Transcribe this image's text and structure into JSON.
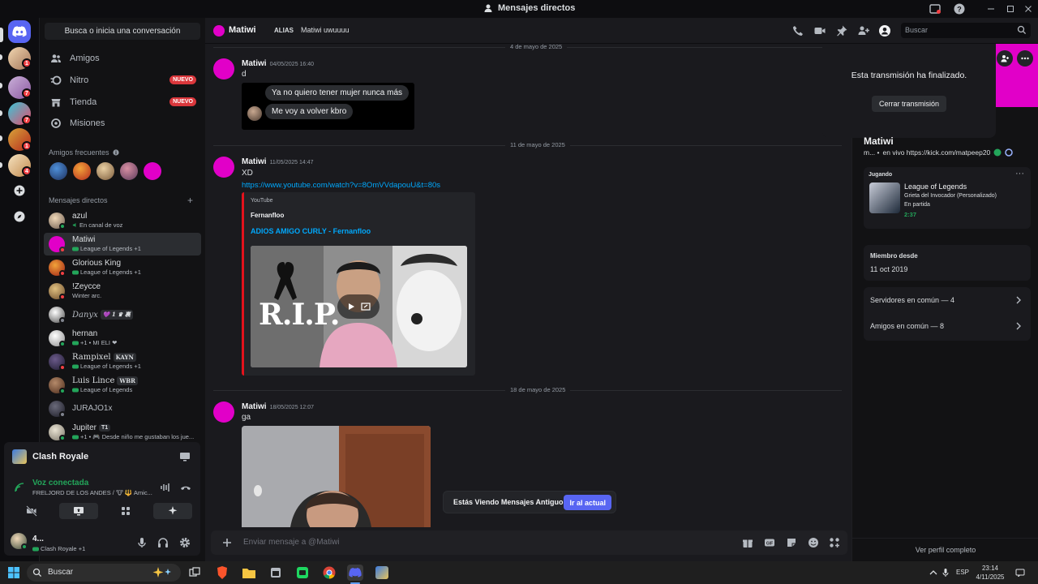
{
  "window": {
    "title": "Mensajes directos"
  },
  "sidebar": {
    "search_button": "Busca o inicia una conversación",
    "nav": [
      {
        "label": "Amigos",
        "icon": "friends-icon",
        "badge": ""
      },
      {
        "label": "Nitro",
        "icon": "nitro-icon",
        "badge": "NUEVO"
      },
      {
        "label": "Tienda",
        "icon": "shop-icon",
        "badge": "NUEVO"
      },
      {
        "label": "Misiones",
        "icon": "quests-icon",
        "badge": ""
      }
    ],
    "frequent_title": "Amigos frecuentes",
    "dm_title": "Mensajes directos",
    "dms": [
      {
        "name": "azul",
        "sub": "En canal de voz",
        "tag": ""
      },
      {
        "name": "Matiwi",
        "sub": "League of Legends +1",
        "tag": ""
      },
      {
        "name": "Glorious King",
        "sub": "League of Legends +1",
        "tag": ""
      },
      {
        "name": "!Zeycce",
        "sub": "Winter arc.",
        "tag": ""
      },
      {
        "name": "Danyx",
        "sub": "",
        "tag": "💜 1 ♛ 裏"
      },
      {
        "name": "hernan",
        "sub": "+1 • MI ELI ❤",
        "tag": ""
      },
      {
        "name": "Rampixel",
        "sub": "League of Legends +1",
        "tag": "KAYN"
      },
      {
        "name": "Luis Lince",
        "sub": "League of Legends",
        "tag": "WBR"
      },
      {
        "name": "JURAJO1x",
        "sub": "",
        "tag": ""
      },
      {
        "name": "Jupiter",
        "sub": "+1 • 🎮 Desde niño me gustaban los jue...",
        "tag": "T1"
      }
    ]
  },
  "voice_panel": {
    "game": "Clash Royale",
    "status": "Voz conectada",
    "channel": "FRELJORD DE LOS ANDES / 🐮 🔱 Amic...",
    "user_name": "4...",
    "user_status": "Clash Royale +1"
  },
  "header": {
    "name": "Matiwi",
    "alias_label": "ALIAS",
    "alias_value": "Matiwi uwuuuu",
    "search_placeholder": "Buscar"
  },
  "messages": {
    "dates": [
      "4 de mayo de 2025",
      "11 de mayo de 2025",
      "18 de mayo de 2025"
    ],
    "groups": [
      {
        "author": "Matiwi",
        "time": "04/05/2025 16:40",
        "text": "d"
      },
      {
        "author": "Matiwi",
        "time": "11/05/2025 14:47",
        "text": "XD"
      },
      {
        "author": "Matiwi",
        "time": "18/05/2025 12:07",
        "text": "ga"
      }
    ],
    "quote_lines": [
      "Ya no quiero tener mujer nunca más",
      "Me voy a volver kbro"
    ],
    "link": "https://www.youtube.com/watch?v=8OmVVdapouU&t=80s",
    "embed": {
      "provider": "YouTube",
      "author": "Fernanfloo",
      "title": "ADIOS AMIGO CURLY - Fernanfloo",
      "thumb_text": "R.I.P."
    }
  },
  "jump_bar": {
    "text": "Estás Viendo Mensajes Antiguos",
    "button": "Ir al actual"
  },
  "composer": {
    "placeholder": "Enviar mensaje a @Matiwi"
  },
  "profile": {
    "stream_ended": "Esta transmisión ha finalizado.",
    "close_stream": "Cerrar transmisión",
    "name": "Matiwi",
    "status_prefix": "m... •",
    "status": "en vivo https://kick.com/matpeep20",
    "playing_label": "Jugando",
    "game_name": "League of Legends",
    "game_mode": "Grieta del Invocador (Personalizado)",
    "game_state": "En partida",
    "game_time": "2:37",
    "member_since_label": "Miembro desde",
    "member_since": "11 oct 2019",
    "mutual_servers": "Servidores en común — 4",
    "mutual_friends": "Amigos en común — 8",
    "full_profile": "Ver perfil completo"
  },
  "taskbar": {
    "search": "Buscar",
    "lang": "ESP",
    "time": "23:14",
    "date": "4/11/2025"
  },
  "colors": {
    "accent": "#5865f2",
    "brand_pink": "#e100c8",
    "online": "#23a55a",
    "dnd": "#f23f43",
    "link": "#00a8fc",
    "youtube": "#e4121c"
  }
}
